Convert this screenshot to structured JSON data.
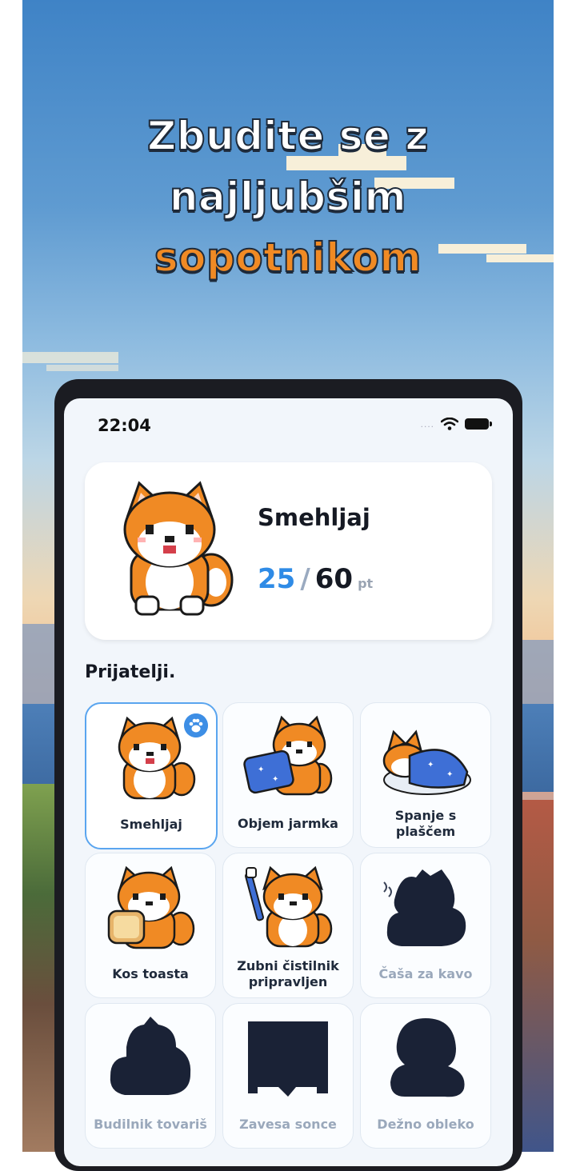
{
  "headline": {
    "line1": "Zbudite se z",
    "line2": "najljubšim",
    "line3": "sopotnikom"
  },
  "status_bar": {
    "time": "22:04",
    "dots": "....",
    "icons": [
      "wifi-icon",
      "battery-icon"
    ]
  },
  "hero": {
    "name": "Smehljaj",
    "points_current": "25",
    "points_separator": "/",
    "points_max": "60",
    "points_unit": "pt"
  },
  "friends_title": "Prijatelji.",
  "friends": [
    {
      "label": "Smehljaj",
      "state": "selected",
      "icon": "shiba-sitting"
    },
    {
      "label": "Objem jarmka",
      "state": "unlocked",
      "icon": "shiba-pillow"
    },
    {
      "label": "Spanje s plaščem",
      "state": "unlocked",
      "icon": "shiba-blanket"
    },
    {
      "label": "Kos toasta",
      "state": "unlocked",
      "icon": "shiba-toast"
    },
    {
      "label": "Zubni čistilnik pripravljen",
      "state": "unlocked",
      "icon": "shiba-toothbrush"
    },
    {
      "label": "Čaša za kavo",
      "state": "locked",
      "icon": "silhouette-coffee"
    },
    {
      "label": "Budilnik tovariš",
      "state": "locked",
      "icon": "silhouette-clock"
    },
    {
      "label": "Zavesa sonce",
      "state": "locked",
      "icon": "silhouette-curtain"
    },
    {
      "label": "Dežno obleko",
      "state": "locked",
      "icon": "silhouette-raincoat"
    }
  ],
  "colors": {
    "accent_orange": "#f08a24",
    "accent_blue": "#2f8be6",
    "silhouette": "#1a2236"
  }
}
